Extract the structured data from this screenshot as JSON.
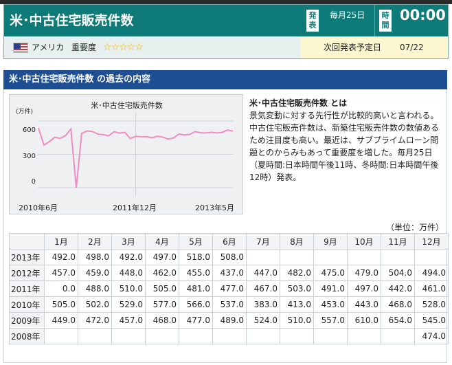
{
  "header": {
    "title": "米･中古住宅販売件数",
    "publish_badge": "発表",
    "publish_date": "毎月25日",
    "time_badge": "時間",
    "publish_time": "00:00",
    "country": "アメリカ",
    "importance_label": "重要度",
    "importance_stars": "☆☆☆☆☆",
    "importance_level": 5,
    "next_label": "次回発表予定日",
    "next_date": "07/22",
    "flag_icon": "us-flag-icon"
  },
  "section": {
    "title": "米･中古住宅販売件数 の過去の内容"
  },
  "chart_data": {
    "type": "line",
    "title": "米･中古住宅販売件数",
    "ylabel": "(万件)",
    "yticks": [
      "600",
      "300",
      "0"
    ],
    "ylim": [
      -80,
      680
    ],
    "xticks": [
      "2010年6月",
      "2011年12月",
      "2013年5月"
    ],
    "grid": true,
    "color": "#f08cc0",
    "x": [
      "2010-06",
      "2010-07",
      "2010-08",
      "2010-09",
      "2010-10",
      "2010-11",
      "2010-12",
      "2011-01",
      "2011-02",
      "2011-03",
      "2011-04",
      "2011-05",
      "2011-06",
      "2011-07",
      "2011-08",
      "2011-09",
      "2011-10",
      "2011-11",
      "2011-12",
      "2012-01",
      "2012-02",
      "2012-03",
      "2012-04",
      "2012-05",
      "2012-06",
      "2012-07",
      "2012-08",
      "2012-09",
      "2012-10",
      "2012-11",
      "2012-12",
      "2013-01",
      "2013-02",
      "2013-03",
      "2013-04",
      "2013-05",
      "2013-06"
    ],
    "values": [
      537,
      383,
      413,
      453,
      443,
      468,
      528,
      0,
      488,
      510,
      505,
      481,
      477,
      467,
      503,
      491,
      497,
      442,
      461,
      457,
      459,
      448,
      462,
      455,
      437,
      447,
      482,
      475,
      479,
      504,
      494,
      492,
      498,
      492,
      497,
      518,
      508
    ]
  },
  "description": {
    "title": "米･中古住宅販売件数 とは",
    "text": "景気変動に対する先行性が比較的高いと言われる。中古住宅販売件数は、新築住宅販売件数の数値あるため注目度も高い。最近は、サブプライムローン問題とのからみもあって重要度を増した。毎月25日（夏時間:日本時間午後11時、冬時間:日本時間午後12時）発表。"
  },
  "table": {
    "unit": "（単位：万件）",
    "headers": [
      "1月",
      "2月",
      "3月",
      "4月",
      "5月",
      "6月",
      "7月",
      "8月",
      "9月",
      "10月",
      "11月",
      "12月"
    ],
    "rows": [
      {
        "year": "2013年",
        "values": [
          "492.0",
          "498.0",
          "492.0",
          "497.0",
          "518.0",
          "508.0",
          "",
          "",
          "",
          "",
          "",
          ""
        ]
      },
      {
        "year": "2012年",
        "values": [
          "457.0",
          "459.0",
          "448.0",
          "462.0",
          "455.0",
          "437.0",
          "447.0",
          "482.0",
          "475.0",
          "479.0",
          "504.0",
          "494.0"
        ]
      },
      {
        "year": "2011年",
        "values": [
          "0.0",
          "488.0",
          "510.0",
          "505.0",
          "481.0",
          "477.0",
          "467.0",
          "503.0",
          "491.0",
          "497.0",
          "442.0",
          "461.0"
        ]
      },
      {
        "year": "2010年",
        "values": [
          "505.0",
          "502.0",
          "529.0",
          "577.0",
          "566.0",
          "537.0",
          "383.0",
          "413.0",
          "453.0",
          "443.0",
          "468.0",
          "528.0"
        ]
      },
      {
        "year": "2009年",
        "values": [
          "449.0",
          "472.0",
          "457.0",
          "468.0",
          "477.0",
          "489.0",
          "524.0",
          "510.0",
          "557.0",
          "610.0",
          "654.0",
          "545.0"
        ]
      },
      {
        "year": "2008年",
        "values": [
          "",
          "",
          "",
          "",
          "",
          "",
          "",
          "",
          "",
          "",
          "",
          "474.0"
        ]
      }
    ]
  }
}
